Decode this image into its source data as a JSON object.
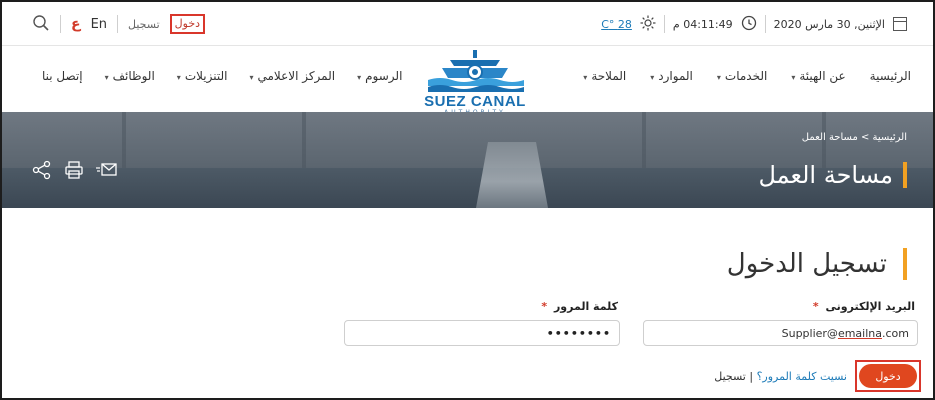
{
  "topbar": {
    "lang_en": "En",
    "lang_ar": "ع",
    "register": "تسجيل",
    "login": "دخول",
    "temperature": "28 °C",
    "time": "04:11:49 م",
    "date": "الإثنين, 30 مارس 2020",
    "icons": [
      "search-icon",
      "weather-sun-icon",
      "clock-icon",
      "calendar-icon"
    ]
  },
  "nav": {
    "right_items": [
      {
        "label": "الرئيسية",
        "caret": ""
      },
      {
        "label": "عن الهيئة",
        "caret": "▾"
      },
      {
        "label": "الخدمات",
        "caret": "▾"
      },
      {
        "label": "الموارد",
        "caret": "▾"
      },
      {
        "label": "الملاحة",
        "caret": "▾"
      }
    ],
    "left_items": [
      {
        "label": "الرسوم",
        "caret": "▾"
      },
      {
        "label": "المركز الاعلامي",
        "caret": "▾"
      },
      {
        "label": "التنزيلات",
        "caret": "▾"
      },
      {
        "label": "الوظائف",
        "caret": "▾"
      },
      {
        "label": "إتصل بنا",
        "caret": ""
      }
    ],
    "logo_text": "SUEZ CANAL",
    "logo_sub": "AUTHORITY"
  },
  "banner": {
    "breadcrumb": "الرئيسية  >  مساحة العمل",
    "title": "مساحة العمل"
  },
  "form": {
    "title": "تسجيل الدخول",
    "email_label": "البريد الإلكترونى",
    "password_label": "كلمة المرور",
    "required_mark": "*",
    "email_prefix": "Supplier@",
    "email_domain": "emailna",
    "email_suffix": ".com",
    "password_value": "••••••••",
    "login_button": "دخول",
    "forgot_link": "نسيت كلمة المرور؟",
    "separator": " | ",
    "register_link": "تسجيل"
  },
  "colors": {
    "accent_orange": "#f2a122",
    "button_red": "#e0471f",
    "highlight_border": "#d9362b",
    "link_blue": "#1d7bb8",
    "logo_blue": "#1a6fb0"
  }
}
